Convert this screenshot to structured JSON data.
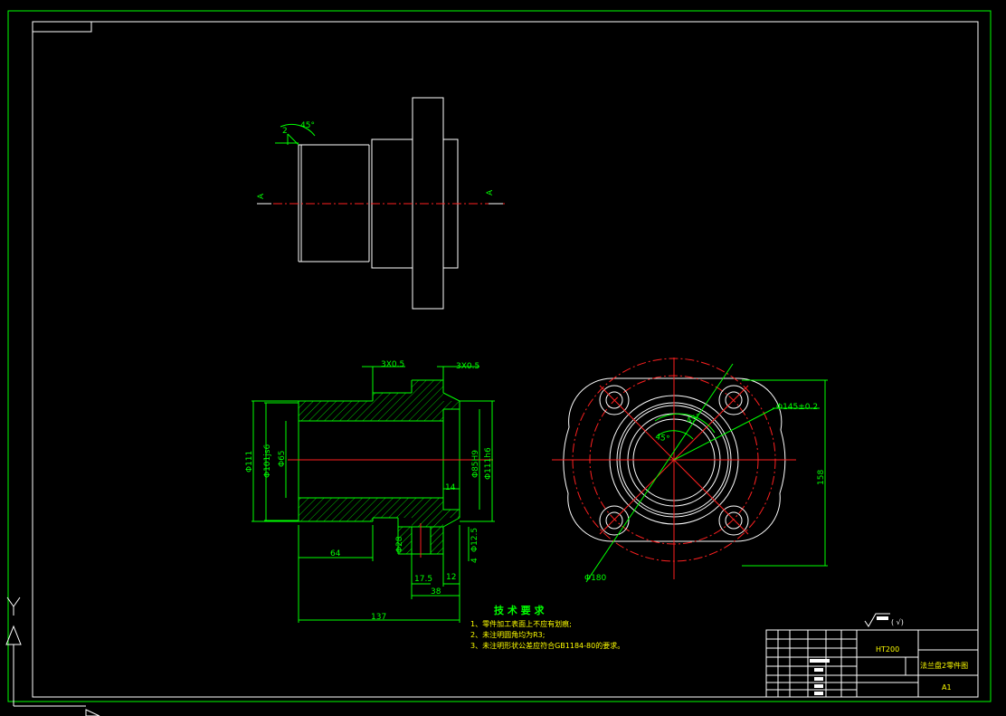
{
  "dimensions": {
    "chamfer_left": "3X0.5",
    "chamfer_right": "3X0.5",
    "d111": "Φ111",
    "d101": "Φ101js6",
    "d65": "Φ65",
    "d85": "Φ85H9",
    "d111h6": "Φ111h6",
    "d28": "Φ28",
    "d12": "Φ12.5",
    "d145": "Φ145±0.2",
    "d180": "Φ180",
    "l64": "64",
    "l14": "14",
    "l17_5": "17.5",
    "l12": "12",
    "l38": "38",
    "l137": "137",
    "l4": "4",
    "h158": "158",
    "ang45a": "45°",
    "ang45b": "45°",
    "ang45c": "45°",
    "l2": "2",
    "sec_a": "A",
    "sec_b": "A"
  },
  "tech": {
    "title": "技 术 要 求",
    "line1": "1、零件加工表面上不应有划痕;",
    "line2": "2、未注明圆角均为R3;",
    "line3": "3、未注明形状公差应符合GB1184-80的要求。"
  },
  "roughness": "( √)",
  "title_block": {
    "material": "HT200",
    "part_name": "法兰盘2零件图",
    "size": "A1"
  }
}
